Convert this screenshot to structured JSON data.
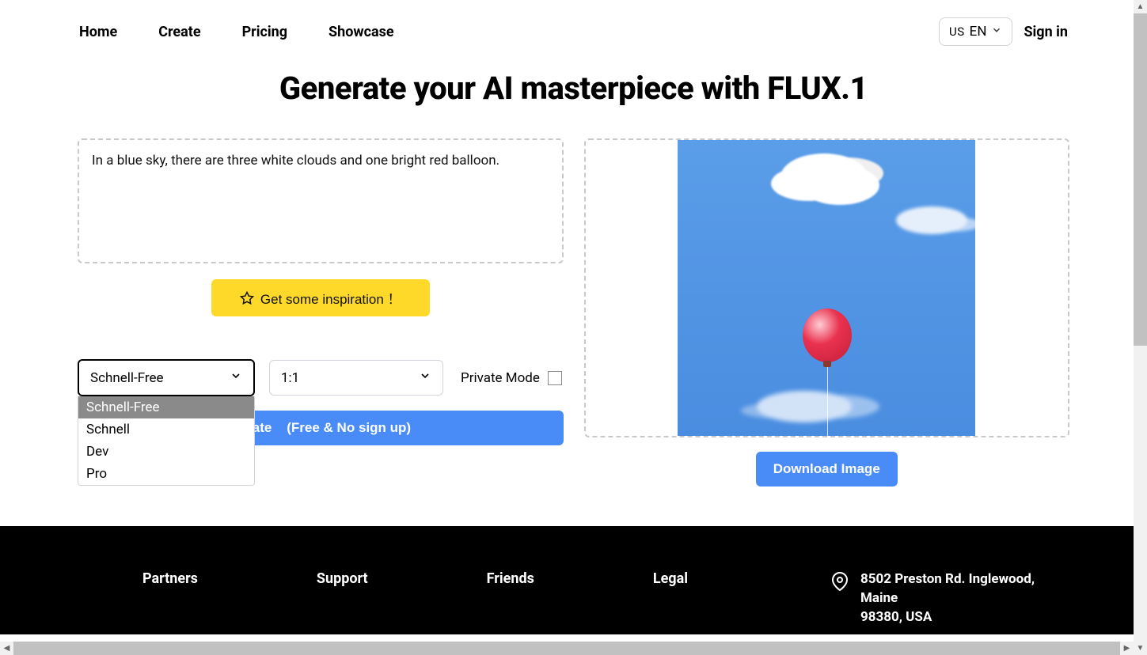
{
  "nav": {
    "home": "Home",
    "create": "Create",
    "pricing": "Pricing",
    "showcase": "Showcase"
  },
  "header": {
    "lang_country": "US",
    "lang_code": "EN",
    "signin": "Sign in"
  },
  "title": "Generate your AI masterpiece with FLUX.1",
  "prompt": {
    "text": "In a blue sky, there are three white clouds and one bright red balloon."
  },
  "inspiration_label": "Get some inspiration ！",
  "model_select": {
    "value": "Schnell-Free",
    "options": [
      "Schnell-Free",
      "Schnell",
      "Dev",
      "Pro"
    ]
  },
  "ratio_select": {
    "value": "1:1"
  },
  "private_label": "Private Mode",
  "create_button": {
    "main": "Create",
    "sub": "(Free & No sign up)"
  },
  "download_label": "Download Image",
  "footer": {
    "col1": "Partners",
    "col2": "Support",
    "col3": "Friends",
    "col4": "Legal",
    "address_line1": "8502 Preston Rd. Inglewood, Maine",
    "address_line2": "98380, USA"
  }
}
